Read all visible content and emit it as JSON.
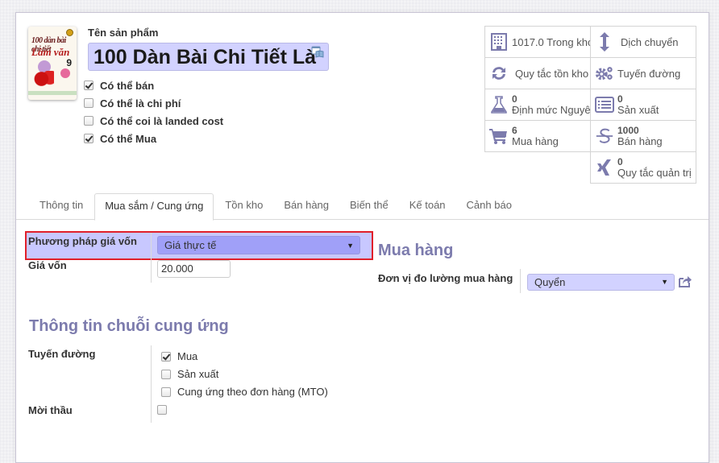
{
  "product": {
    "name_label": "Tên sản phẩm",
    "name_value": "100 Dàn Bài Chi Tiết Là",
    "image_alt": "100 dàn bài chi tiết Làm văn 9",
    "cover": {
      "line1": "100 dàn bài chi tiết",
      "line2": "Làm văn",
      "number": "9"
    },
    "options": [
      {
        "label": "Có thể bán",
        "checked": true
      },
      {
        "label": "Có thể là chi phí",
        "checked": false
      },
      {
        "label": "Có thể coi là landed cost",
        "checked": false
      },
      {
        "label": "Có thể Mua",
        "checked": true
      }
    ]
  },
  "smart_buttons": [
    {
      "icon": "building-icon",
      "value": "1017.0",
      "label": "Trong kho",
      "text": "1017.0 Trong kho"
    },
    {
      "icon": "arrows-vertical-icon",
      "label": "Dịch chuyển"
    },
    {
      "icon": "refresh-icon",
      "label": "Quy tắc tồn kho"
    },
    {
      "icon": "cogs-icon",
      "label": "Tuyến đường"
    },
    {
      "icon": "flask-icon",
      "value": "0",
      "label": "Định mức Nguyên"
    },
    {
      "icon": "list-alt-icon",
      "value": "0",
      "label": "Sản xuất"
    },
    {
      "icon": "shopping-cart-icon",
      "value": "6",
      "label": "Mua hàng"
    },
    {
      "icon": "dollar-icon",
      "value": "1000",
      "label": "Bán hàng"
    },
    {
      "icon": "xing-icon",
      "value": "0",
      "label": "Quy tắc quản trị"
    }
  ],
  "tabs": [
    {
      "label": "Thông tin",
      "active": false
    },
    {
      "label": "Mua sắm / Cung ứng",
      "active": true
    },
    {
      "label": "Tồn kho",
      "active": false
    },
    {
      "label": "Bán hàng",
      "active": false
    },
    {
      "label": "Biến thể",
      "active": false
    },
    {
      "label": "Kế toán",
      "active": false
    },
    {
      "label": "Cảnh báo",
      "active": false
    }
  ],
  "costing": {
    "method_label": "Phương pháp giá vốn",
    "method_value": "Giá thực tế",
    "cost_label": "Giá vốn",
    "cost_value": "20.000"
  },
  "purchase": {
    "title": "Mua hàng",
    "uom_label": "Đơn vị đo lường mua hàng",
    "uom_value": "Quyển"
  },
  "supply_chain": {
    "title": "Thông tin chuỗi cung ứng",
    "routes_label": "Tuyến đường",
    "routes": [
      {
        "label": "Mua",
        "checked": true
      },
      {
        "label": "Sản xuất",
        "checked": false
      },
      {
        "label": "Cung ứng theo đơn hàng (MTO)",
        "checked": false
      }
    ],
    "tender_label": "Mời thầu",
    "tender_checked": false
  },
  "colors": {
    "accent": "#7c7bad",
    "highlight": "#e0202a",
    "required_field": "#d2d2ff",
    "selected_field": "#a0a0f8"
  }
}
